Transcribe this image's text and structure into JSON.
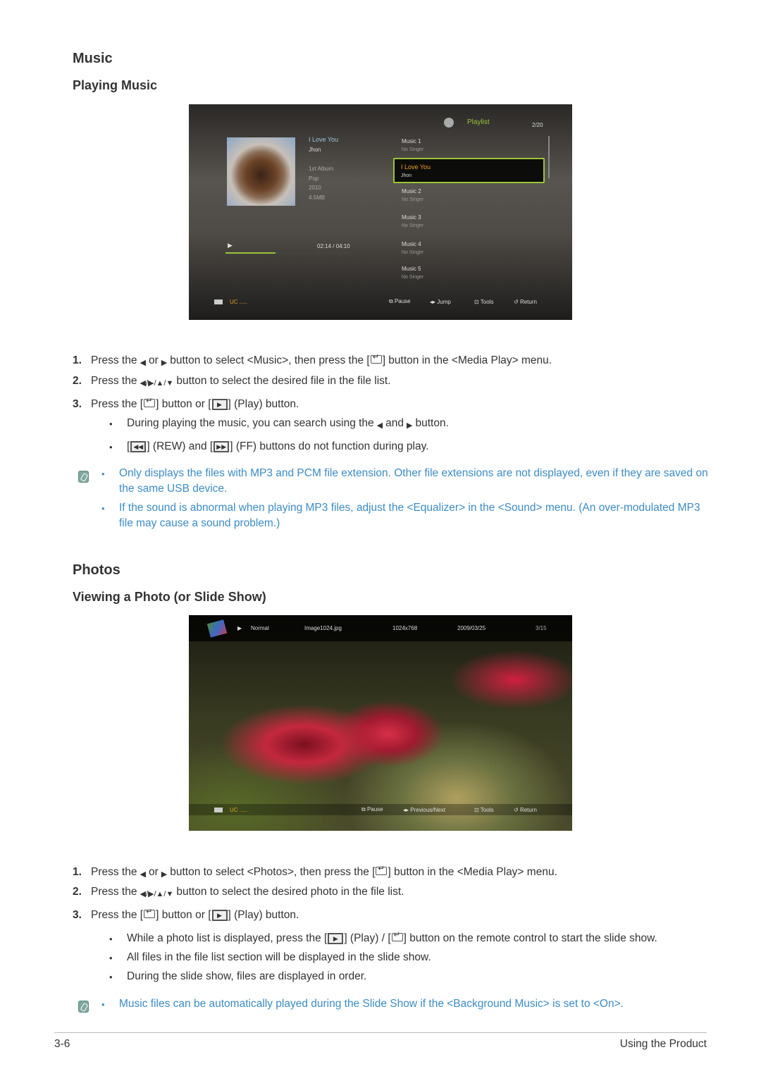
{
  "music_section": {
    "title": "Music",
    "subtitle": "Playing Music"
  },
  "music_screen": {
    "playlist_label": "Playlist",
    "count": "2/20",
    "now_title": "I Love You",
    "now_artist": "Jhon",
    "album": "1st Album",
    "genre": "Pop",
    "year": "2010",
    "size": "4.5MB",
    "time": "02:14 / 04:10",
    "progress": 0.4,
    "items": [
      {
        "title": "Music 1",
        "artist": "No Singer"
      },
      {
        "title": "I Love You",
        "artist": "Jhon"
      },
      {
        "title": "Music 2",
        "artist": "No Singer"
      },
      {
        "title": "Music 3",
        "artist": "No Singer"
      },
      {
        "title": "Music 4",
        "artist": "No Singer"
      },
      {
        "title": "Music 5",
        "artist": "No Singer"
      }
    ],
    "device": "UC .....",
    "pause": "Pause",
    "jump": "Jump",
    "tools": "Tools",
    "return": "Return",
    "accent": "#9ac43a"
  },
  "music_steps": {
    "s1": {
      "n": "1.",
      "a": "Press the",
      "b": "or",
      "c": "button to select <Music>, then press the [",
      "d": "] button in the <Media Play> menu."
    },
    "s2": {
      "n": "2.",
      "a": "Press the",
      "b": "button to select the desired file in the file list."
    },
    "s3": {
      "n": "3.",
      "a": "Press the [",
      "b": "] button or [",
      "c": "] (Play) button."
    },
    "b1": {
      "a": "During playing the music, you can search using the",
      "b": "and",
      "c": "button."
    },
    "b2": {
      "a": "[",
      "b": "] (REW) and [",
      "c": "] (FF) buttons do not function during play."
    },
    "notes": [
      "Only displays the files with MP3 and PCM file extension. Other file extensions are not displayed, even if they are saved on the same USB device.",
      "If the sound is abnormal when playing MP3 files, adjust the <Equalizer> in the <Sound> menu. (An over-modulated MP3 file may cause a sound problem.)"
    ]
  },
  "photo_section": {
    "title": "Photos",
    "subtitle": "Viewing a Photo (or Slide Show)"
  },
  "photo_screen": {
    "mode": "Normal",
    "file": "Image1024.jpg",
    "resolution": "1024x768",
    "date": "2009/03/25",
    "count": "3/15",
    "device": "UC .....",
    "pause": "Pause",
    "prevnext": "Previous/Next",
    "tools": "Tools",
    "return": "Return"
  },
  "photo_steps": {
    "s1": {
      "n": "1.",
      "a": "Press the",
      "b": "or",
      "c": "button to select <Photos>, then press the [",
      "d": "] button in the <Media Play> menu."
    },
    "s2": {
      "n": "2.",
      "a": "Press the",
      "b": "button to select the desired photo in the file list."
    },
    "s3": {
      "n": "3.",
      "a": "Press the [",
      "b": "] button or [",
      "c": "] (Play) button."
    },
    "b1": {
      "a": "While a photo list is displayed, press the [",
      "b": "] (Play) / [",
      "c": "] button on the remote control to start the slide show."
    },
    "b2": "All files in the file list section will be displayed in the slide show.",
    "b3": "During the slide show, files are displayed in order.",
    "note": "Music files can be automatically played during the Slide Show if the <Background Music> is set to <On>."
  },
  "footer": {
    "page": "3-6",
    "chapter": "Using the Product"
  }
}
